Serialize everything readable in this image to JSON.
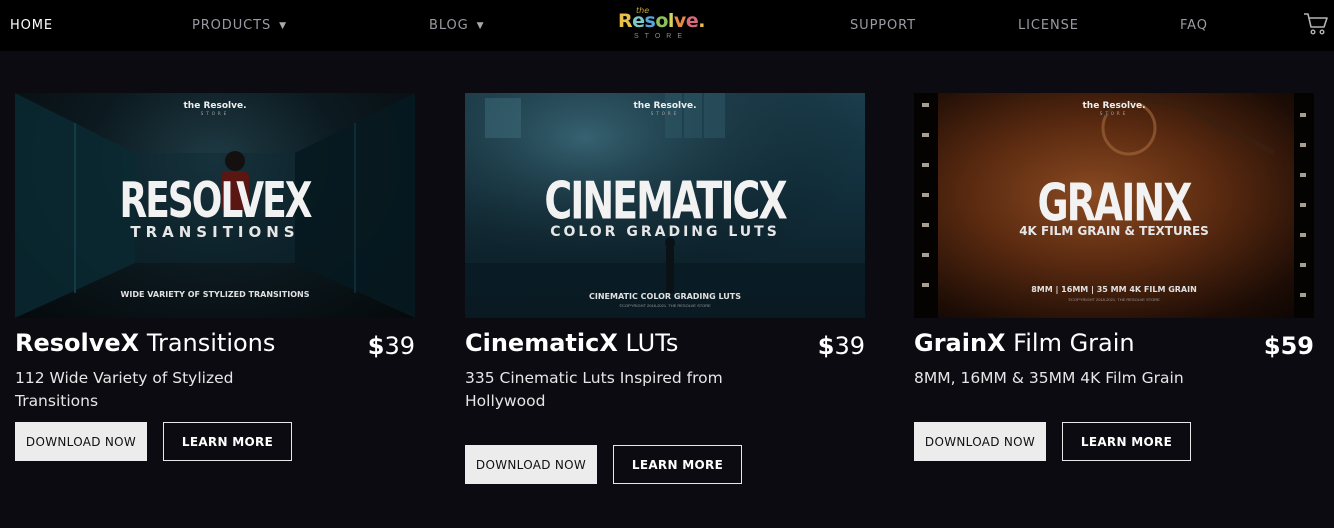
{
  "nav": {
    "home": "HOME",
    "products": "PRODUCTS",
    "blog": "BLOG",
    "support": "SUPPORT",
    "license": "LICENSE",
    "faq": "FAQ",
    "logo_the": "the",
    "logo_brand": "Resolve.",
    "logo_store": "STORE",
    "cart_icon": "cart-icon"
  },
  "products": [
    {
      "name_bold": "ResolveX",
      "name_light": " Transitions",
      "price_symbol": "$",
      "price_value": "39",
      "description": "112 Wide Variety of Stylized Transitions",
      "download_label": "DOWNLOAD NOW",
      "learn_label": "LEARN MORE",
      "image": {
        "logo": "the Resolve.",
        "logo_store": "STORE",
        "headline": "RESOLVEX",
        "subline": "TRANSITIONS",
        "footline": "WIDE VARIETY OF STYLIZED TRANSITIONS"
      }
    },
    {
      "name_bold": "CinematicX",
      "name_light": " LUTs",
      "price_symbol": "$",
      "price_value": "39",
      "description": "335 Cinematic Luts Inspired from Hollywood",
      "download_label": "DOWNLOAD NOW",
      "learn_label": "LEARN MORE",
      "image": {
        "logo": "the Resolve.",
        "logo_store": "STORE",
        "headline": "CINEMATICX",
        "subline": "COLOR GRADING LUTS",
        "footline": "CINEMATIC COLOR GRADING LUTS",
        "copyright": "©COPYRIGHT 2018-2021. THE RESOLVE STORE"
      }
    },
    {
      "name_bold": "GrainX",
      "name_light": " Film Grain",
      "price_symbol": "$",
      "price_value": "59",
      "description": "8MM, 16MM & 35MM 4K Film Grain",
      "download_label": "DOWNLOAD NOW",
      "learn_label": "LEARN MORE",
      "image": {
        "logo": "the Resolve.",
        "logo_store": "STORE",
        "headline": "GRAINX",
        "subline": "4K FILM GRAIN & TEXTURES",
        "footline": "8MM | 16MM | 35 MM 4K FILM GRAIN",
        "copyright": "©COPYRIGHT 2018-2021. THE RESOLVE STORE"
      }
    }
  ]
}
